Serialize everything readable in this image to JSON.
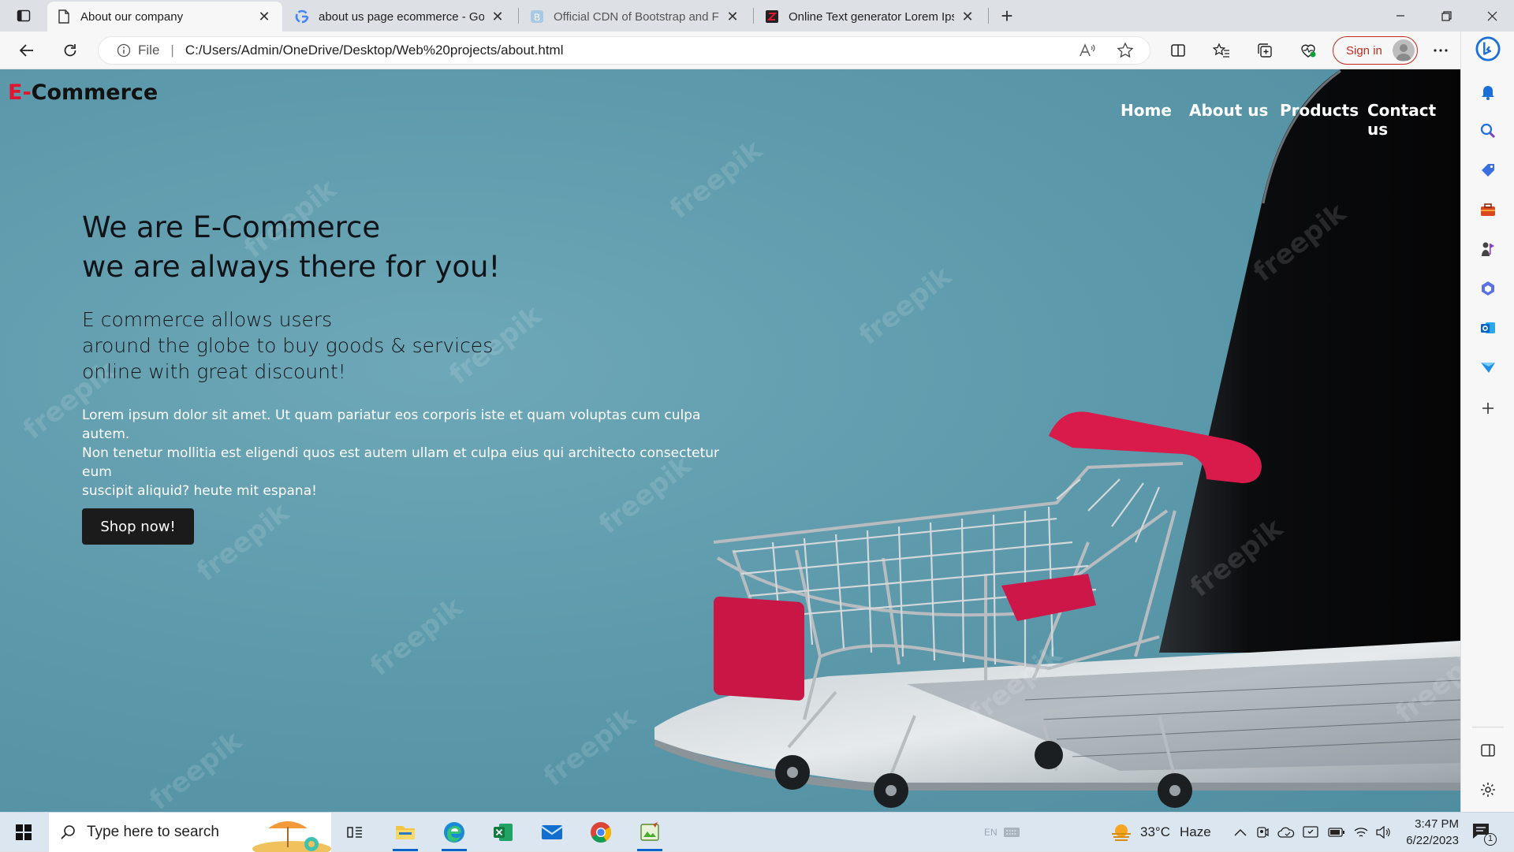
{
  "browser": {
    "tabs": [
      {
        "title": "About our company",
        "active": true,
        "favicon": "page-icon"
      },
      {
        "title": "about us page ecommerce - Goo",
        "active": false,
        "favicon": "google-icon"
      },
      {
        "title": "Official CDN of Bootstrap and Fo",
        "active": false,
        "favicon": "bootstrap-icon"
      },
      {
        "title": "Online Text generator Lorem Ipsu",
        "active": false,
        "favicon": "lorem-icon"
      }
    ],
    "address": {
      "scheme_label": "File",
      "separator": "|",
      "url": "C:/Users/Admin/OneDrive/Desktop/Web%20projects/about.html"
    },
    "sign_in_label": "Sign in",
    "accent_color": "#c42b1c"
  },
  "site": {
    "brand_prefix": "E-",
    "brand_name": "Commerce",
    "brand_accent": "#e0152f",
    "nav": [
      "Home",
      "About us",
      "Products",
      "Contact us"
    ],
    "heading_line1": "We are E-Commerce",
    "heading_line2": "we are always there for you!",
    "sub_line1": "E commerce allows users",
    "sub_line2": "around the globe to buy goods & services",
    "sub_line3": "online with great discount!",
    "paragraph_line1": "Lorem ipsum dolor sit amet. Ut quam pariatur eos corporis iste et quam voluptas cum culpa autem.",
    "paragraph_line2": "Non tenetur mollitia est eligendi quos est autem ullam et culpa eius qui architecto consectetur eum",
    "paragraph_line3": "suscipit aliquid? heute mit espana!",
    "cta_label": "Shop now!",
    "watermark_text": "freepik"
  },
  "sidebar": {
    "icons": [
      "bing-icon",
      "bell-icon",
      "search-icon",
      "tag-icon",
      "toolbox-icon",
      "games-icon",
      "office-icon",
      "outlook-icon",
      "send-icon",
      "add-icon",
      "split-screen-icon",
      "settings-icon"
    ]
  },
  "taskbar": {
    "search_placeholder": "Type here to search",
    "weather_temp": "33°C",
    "weather_text": "Haze",
    "lang": "EN",
    "time": "3:47 PM",
    "date": "6/22/2023",
    "notification_count": "1"
  }
}
